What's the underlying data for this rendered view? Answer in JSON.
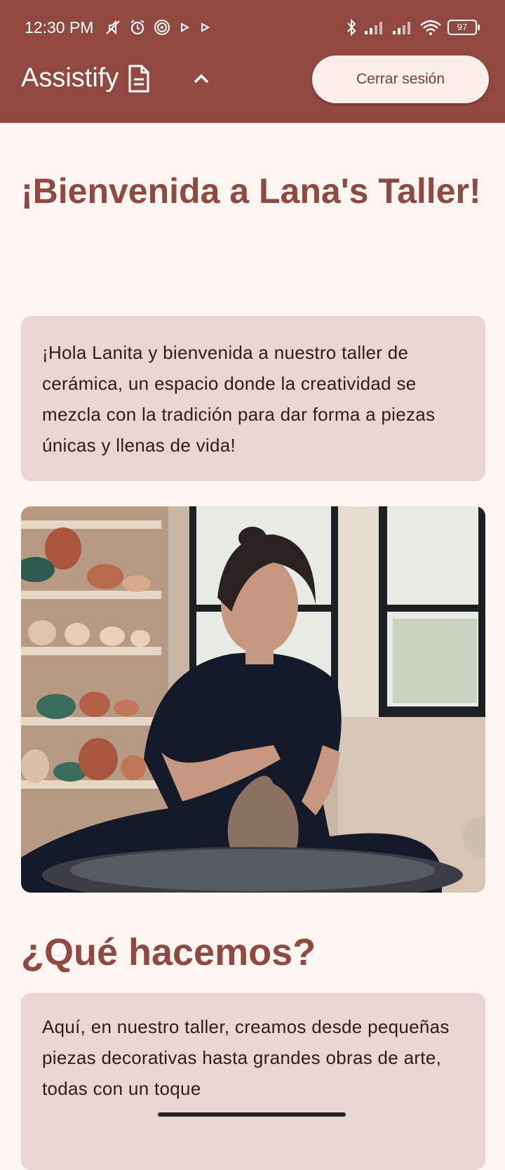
{
  "status_bar": {
    "time": "12:30 PM",
    "battery": "97"
  },
  "app_bar": {
    "title": "Assistify",
    "logout_label": "Cerrar sesión",
    "colors": {
      "bar": "#904840",
      "button": "#fcecea"
    }
  },
  "main": {
    "welcome_title": "¡Bienvenida a Lana's Taller!",
    "welcome_text": "¡Hola Lanita y bienvenida a nuestro taller de cerámica, un espacio donde la creatividad se mezcla con la tradición para dar forma a piezas únicas y llenas de vida!",
    "section_title": "¿Qué hacemos?",
    "section_text": "Aquí, en nuestro taller, creamos desde pequeñas piezas decorativas hasta grandes obras de arte, todas con un toque"
  }
}
